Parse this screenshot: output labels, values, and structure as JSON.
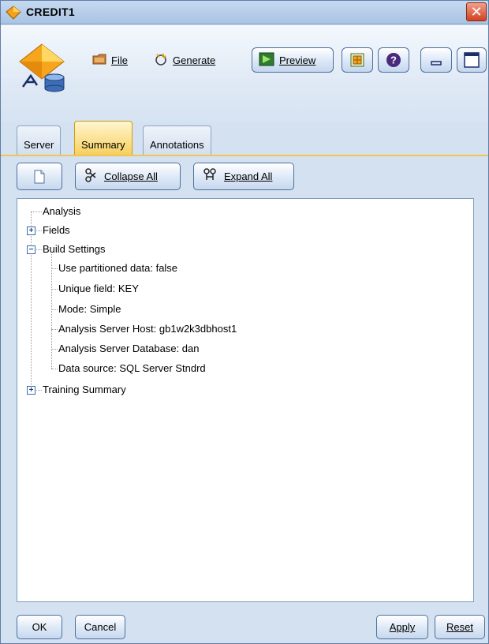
{
  "window": {
    "title": "CREDIT1",
    "close_glyph": "✕"
  },
  "toolbar": {
    "file_label": "File",
    "generate_label": "Generate",
    "preview_label": "Preview",
    "icons": [
      "node-icon",
      "file-icon",
      "generate-icon",
      "preview-icon",
      "table-icon",
      "help-icon",
      "minimize-icon",
      "maximize-icon"
    ]
  },
  "tabs": [
    {
      "label": "Server",
      "active": false
    },
    {
      "label": "Summary",
      "active": true
    },
    {
      "label": "Annotations",
      "active": false
    }
  ],
  "summary_toolbar": {
    "collapse_label": "Collapse All",
    "expand_label": "Expand All"
  },
  "tree": {
    "analysis": "Analysis",
    "fields": "Fields",
    "build_settings": "Build Settings",
    "build_children": [
      "Use partitioned data: false",
      "Unique field: KEY",
      "Mode: Simple",
      "Analysis Server Host: gb1w2k3dbhost1",
      "Analysis Server Database: dan",
      "Data source: SQL Server Stndrd"
    ],
    "training_summary": "Training Summary"
  },
  "buttons": {
    "ok": "OK",
    "cancel": "Cancel",
    "apply": "Apply",
    "reset": "Reset"
  },
  "colors": {
    "accent_tab": "#f7cf5d",
    "window_bg": "#d4e1f0",
    "close_red": "#d2411f"
  }
}
